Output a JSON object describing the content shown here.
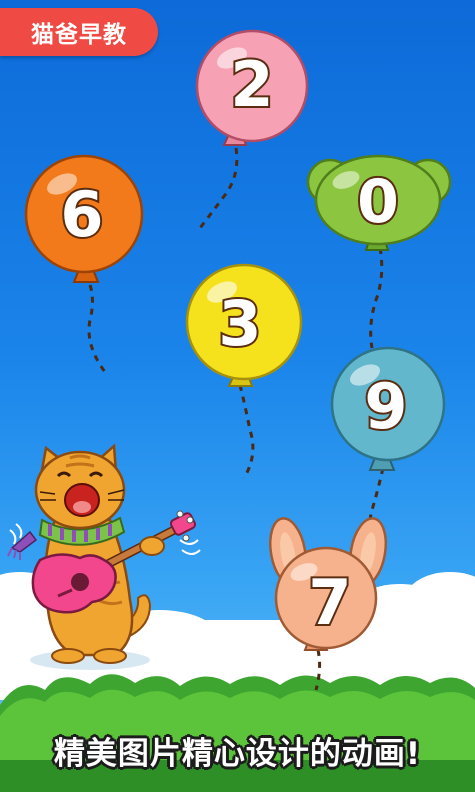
{
  "badge": {
    "label": "猫爸早教"
  },
  "balloons": [
    {
      "id": "two",
      "number": "2",
      "color": "#f6a2b4",
      "shape": "round"
    },
    {
      "id": "six",
      "number": "6",
      "color": "#f27a1a",
      "shape": "round"
    },
    {
      "id": "zero",
      "number": "0",
      "color": "#8cc640",
      "shape": "bear"
    },
    {
      "id": "three",
      "number": "3",
      "color": "#f5e21c",
      "shape": "round"
    },
    {
      "id": "nine",
      "number": "9",
      "color": "#62b7cc",
      "shape": "round"
    },
    {
      "id": "seven",
      "number": "7",
      "color": "#f6b28c",
      "shape": "bunny"
    }
  ],
  "caption": {
    "text": "精美图片精心设计的动画!"
  },
  "colors": {
    "sky_top": "#0d6ad8",
    "sky_bottom": "#7cc8fa",
    "grass": "#3ea531",
    "badge": "#ef4a43"
  }
}
